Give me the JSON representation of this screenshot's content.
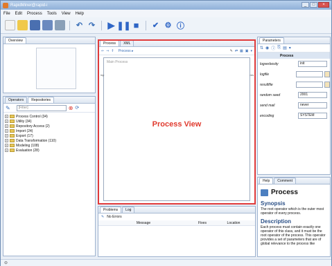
{
  "window": {
    "title": "RapidMiner@rapid-i",
    "controls": [
      "_",
      "□",
      "×"
    ]
  },
  "menu": [
    "File",
    "Edit",
    "Process",
    "Tools",
    "View",
    "Help"
  ],
  "toolbar": {
    "icons": [
      "new-icon",
      "open-icon",
      "save-icon",
      "save-as-icon",
      "print-icon",
      "undo-icon",
      "redo-icon",
      "run-icon",
      "pause-icon",
      "stop-icon",
      "validate-icon",
      "settings-icon",
      "info-icon"
    ]
  },
  "overview": {
    "tab": "Overview"
  },
  "repository": {
    "tabs": [
      "Operators",
      "Repositories"
    ],
    "filter_placeholder": "[Filter]",
    "items": [
      "Process Control (34)",
      "Utility (34)",
      "Repository Access (2)",
      "Import (24)",
      "Export (17)",
      "Data Transformation (110)",
      "Modeling (108)",
      "Evaluation (28)"
    ]
  },
  "process": {
    "tabs": [
      "Process",
      "XML"
    ],
    "breadcrumb": "Process ▸",
    "canvas_label": "Main Process",
    "port_inp": "inp",
    "port_res": "res",
    "center_text": "Process View"
  },
  "parameters": {
    "tab": "Parameters",
    "heading": "Process",
    "rows": [
      {
        "label": "logverbosity",
        "value": "init",
        "button": false
      },
      {
        "label": "logfile",
        "value": "",
        "button": true
      },
      {
        "label": "resultfile",
        "value": "",
        "button": true
      },
      {
        "label": "random seed",
        "value": "2001",
        "button": false
      },
      {
        "label": "send mail",
        "value": "never",
        "button": false
      },
      {
        "label": "encoding",
        "value": "SYSTEM",
        "button": false
      }
    ]
  },
  "help": {
    "tabs": [
      "Help",
      "Comment"
    ],
    "title": "Process",
    "synopsis_heading": "Synopsis",
    "synopsis_text": "The root operator which is the outer most operator of every process.",
    "description_heading": "Description",
    "description_text": "Each process must contain exactly one operator of this class, and it must be the root operator of the process. This operator provides a set of parameters that are of global relevance to the process like"
  },
  "problems": {
    "tabs": [
      "Problems",
      "Log"
    ],
    "status": "No Errors",
    "columns": [
      "Message",
      "Fixes",
      "Location"
    ]
  },
  "colors": {
    "accent_red": "#e03a2e",
    "frame_blue": "#6c8bb3"
  }
}
